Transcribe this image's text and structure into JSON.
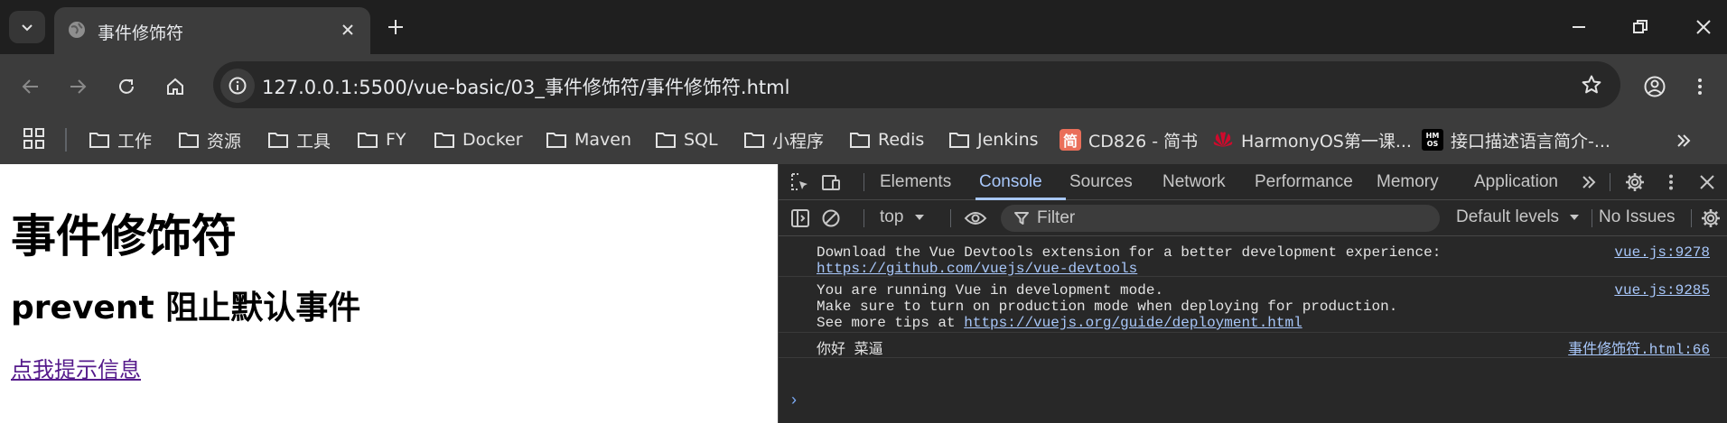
{
  "browser": {
    "tab": {
      "title": "事件修饰符"
    },
    "address_bar": {
      "url": "127.0.0.1:5500/vue-basic/03_事件修饰符/事件修饰符.html"
    },
    "bookmarks": [
      {
        "label": "工作",
        "icon": "folder-icon"
      },
      {
        "label": "资源",
        "icon": "folder-icon"
      },
      {
        "label": "工具",
        "icon": "folder-icon"
      },
      {
        "label": "FY",
        "icon": "folder-icon"
      },
      {
        "label": "Docker",
        "icon": "folder-icon"
      },
      {
        "label": "Maven",
        "icon": "folder-icon"
      },
      {
        "label": "SQL",
        "icon": "folder-icon"
      },
      {
        "label": "小程序",
        "icon": "folder-icon"
      },
      {
        "label": "Redis",
        "icon": "folder-icon"
      },
      {
        "label": "Jenkins",
        "icon": "folder-icon"
      },
      {
        "label": "CD826 - 简书",
        "icon": "jianshu-icon",
        "icon_text": "简"
      },
      {
        "label": "HarmonyOS第一课...",
        "icon": "huawei-icon"
      },
      {
        "label": "接口描述语言简介-...",
        "icon": "harmonyos-icon",
        "icon_text": "HM OS"
      }
    ]
  },
  "page": {
    "heading": "事件修饰符",
    "subheading": "prevent 阻止默认事件",
    "link_text": "点我提示信息"
  },
  "devtools": {
    "tabs": [
      "Elements",
      "Console",
      "Sources",
      "Network",
      "Performance",
      "Memory",
      "Application"
    ],
    "active_tab": "Console",
    "console_bar": {
      "context": "top",
      "filter_placeholder": "Filter",
      "levels": "Default levels",
      "issues": "No Issues"
    },
    "messages": [
      {
        "lines": [
          "Download the Vue Devtools extension for a better development experience:"
        ],
        "link": "https://github.com/vuejs/vue-devtools",
        "source": "vue.js:9278"
      },
      {
        "lines": [
          "You are running Vue in development mode.",
          "Make sure to turn on production mode when deploying for production."
        ],
        "prefix": "See more tips at ",
        "link": "https://vuejs.org/guide/deployment.html",
        "source": "vue.js:9285"
      },
      {
        "lines": [
          "你好 菜逼"
        ],
        "source": "事件修饰符.html:66"
      }
    ],
    "prompt_symbol": "›"
  },
  "colors": {
    "tabstrip_bg": "#1f1f1f",
    "toolbar_bg": "#3c3c3c",
    "devtools_bg": "#282828",
    "devtools_accent": "#a8c7fa",
    "visited_link": "#551a8b"
  }
}
